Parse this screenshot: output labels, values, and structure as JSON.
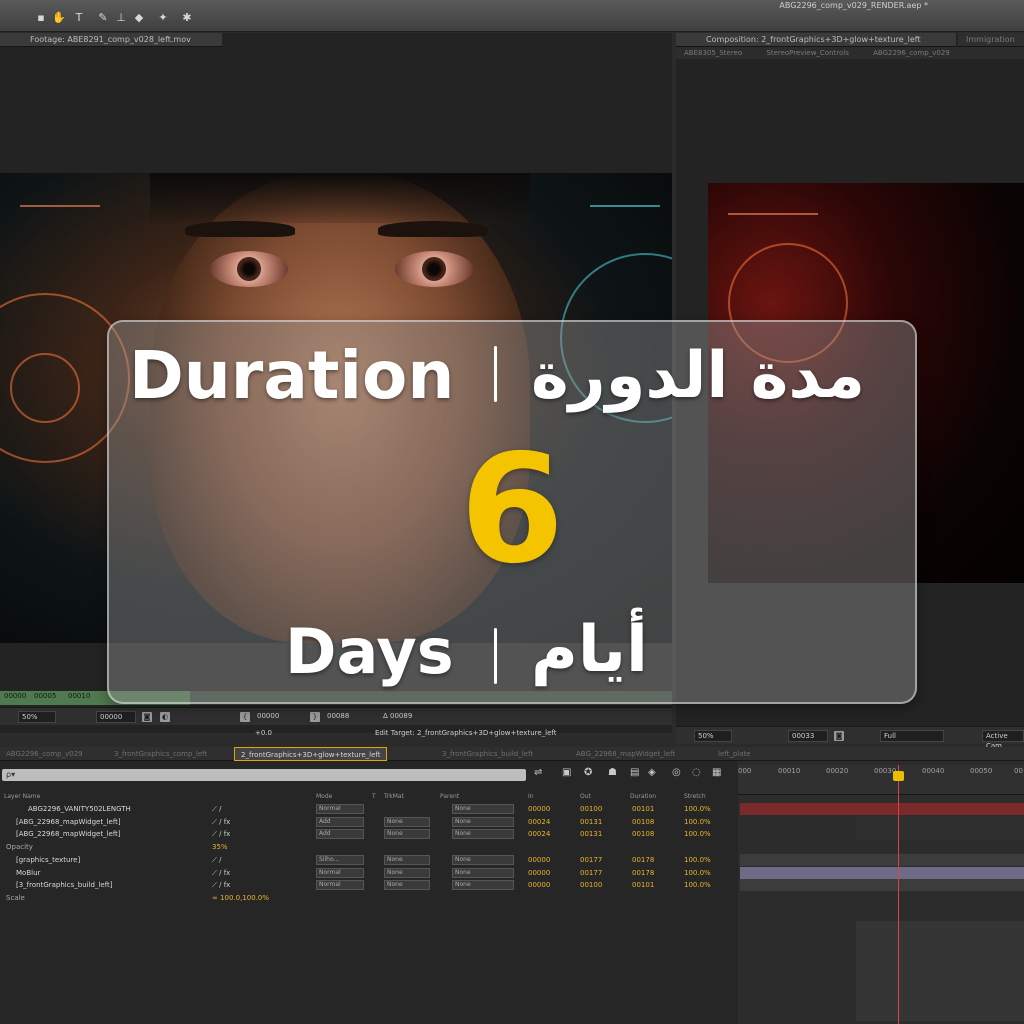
{
  "app": {
    "document_title": "ABG2296_comp_v029_RENDER.aep *"
  },
  "footage_panel": {
    "tab_label": "Footage: ABE8291_comp_v028_left.mov",
    "zoom": "50%",
    "timecode": "00000",
    "start": "00000",
    "end": "00088",
    "duration": "Δ 00089",
    "exposure": "+0.0",
    "edit_target": "Edit Target: 2_frontGraphics+3D+glow+texture_left",
    "ruler_ticks": [
      "00000",
      "00005",
      "00010"
    ]
  },
  "comp_panel": {
    "tab_label": "Composition: 2_frontGraphics+3D+glow+texture_left",
    "tab2_label": "Immigration",
    "subtabs": [
      "ABE8305_Stereo",
      "StereoPreview_Controls",
      "ABG2296_comp_v029"
    ],
    "zoom": "50%",
    "timecode": "00033",
    "resolution": "Full",
    "camera": "Active Cam"
  },
  "timeline": {
    "tabs": [
      {
        "label": "ABG2296_comp_v029",
        "active": false
      },
      {
        "label": "3_frontGraphics_comp_left",
        "active": false
      },
      {
        "label": "2_frontGraphics+3D+glow+texture_left",
        "active": true
      },
      {
        "label": "3_frontGraphics_build_left",
        "active": false
      },
      {
        "label": "ABG_22968_mapWidget_left",
        "active": false
      },
      {
        "label": "left_plate",
        "active": false
      }
    ],
    "search_placeholder": "ρ▾",
    "columns": {
      "layer_name": "Layer Name",
      "mode": "Mode",
      "t": "T",
      "trkmat": "TrkMat",
      "parent": "Parent",
      "in": "In",
      "out": "Out",
      "duration": "Duration",
      "stretch": "Stretch"
    },
    "layers": [
      {
        "name": "ABG2296_VANITY502LENGTH",
        "mode": "Normal",
        "trkmat": "",
        "parent": "None",
        "in": "00000",
        "out": "00100",
        "duration": "00101",
        "stretch": "100.0%"
      },
      {
        "name": "[ABG_22968_mapWidget_left]",
        "mode": "Add",
        "trkmat": "None",
        "parent": "None",
        "in": "00024",
        "out": "00131",
        "duration": "00108",
        "stretch": "100.0%"
      },
      {
        "name": "[ABG_22968_mapWidget_left]",
        "mode": "Add",
        "trkmat": "None",
        "parent": "None",
        "in": "00024",
        "out": "00131",
        "duration": "00108",
        "stretch": "100.0%"
      },
      {
        "name": "[graphics_texture]",
        "mode": "Silho...",
        "trkmat": "None",
        "parent": "None",
        "in": "00000",
        "out": "00177",
        "duration": "00178",
        "stretch": "100.0%"
      },
      {
        "name": "MoBlur",
        "mode": "Normal",
        "trkmat": "None",
        "parent": "None",
        "in": "00000",
        "out": "00177",
        "duration": "00178",
        "stretch": "100.0%"
      },
      {
        "name": "[3_frontGraphics_build_left]",
        "mode": "Normal",
        "trkmat": "None",
        "parent": "None",
        "in": "00000",
        "out": "00100",
        "duration": "00101",
        "stretch": "100.0%"
      }
    ],
    "opacity_label": "Opacity",
    "opacity_value": "35%",
    "scale_label": "Scale",
    "scale_value": "∞ 100.0,100.0%",
    "ruler_ticks": [
      "000",
      "00010",
      "00020",
      "00030",
      "00040",
      "00050",
      "00"
    ]
  },
  "overlay": {
    "title_en": "Duration",
    "title_ar": "مدة الدورة",
    "number": "6",
    "unit_en": "Days",
    "unit_ar": "أيام",
    "number_color": "#f5c400"
  }
}
